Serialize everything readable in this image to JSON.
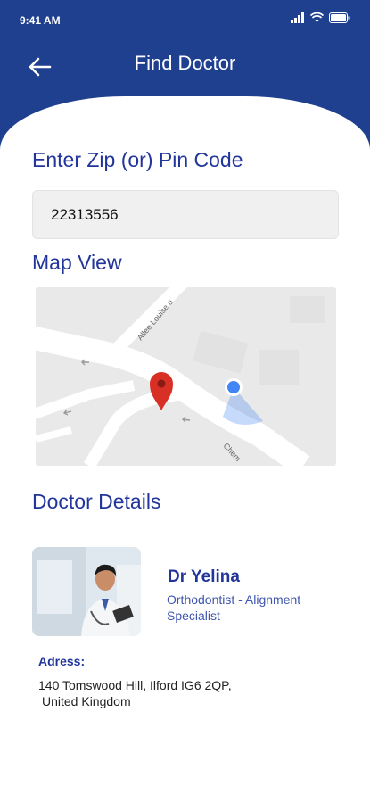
{
  "status": {
    "time": "9:41 AM"
  },
  "header": {
    "title": "Find Doctor"
  },
  "zip": {
    "label": "Enter Zip (or) Pin Code",
    "value": "22313556"
  },
  "map": {
    "label": "Map View",
    "street_1": "Allee Louise o",
    "street_2": "Chem"
  },
  "doctor": {
    "section_label": "Doctor Details",
    "name": "Dr Yelina",
    "specialty": "Orthodontist - Alignment Specialist",
    "address_label": "Adress:",
    "address_line1": "140 Tomswood Hill, Ilford IG6 2QP,",
    "address_line2": "United Kingdom"
  },
  "colors": {
    "primary": "#1f3f8f",
    "accent": "#22359a",
    "pin": "#d93025",
    "location_dot": "#4285f4"
  }
}
